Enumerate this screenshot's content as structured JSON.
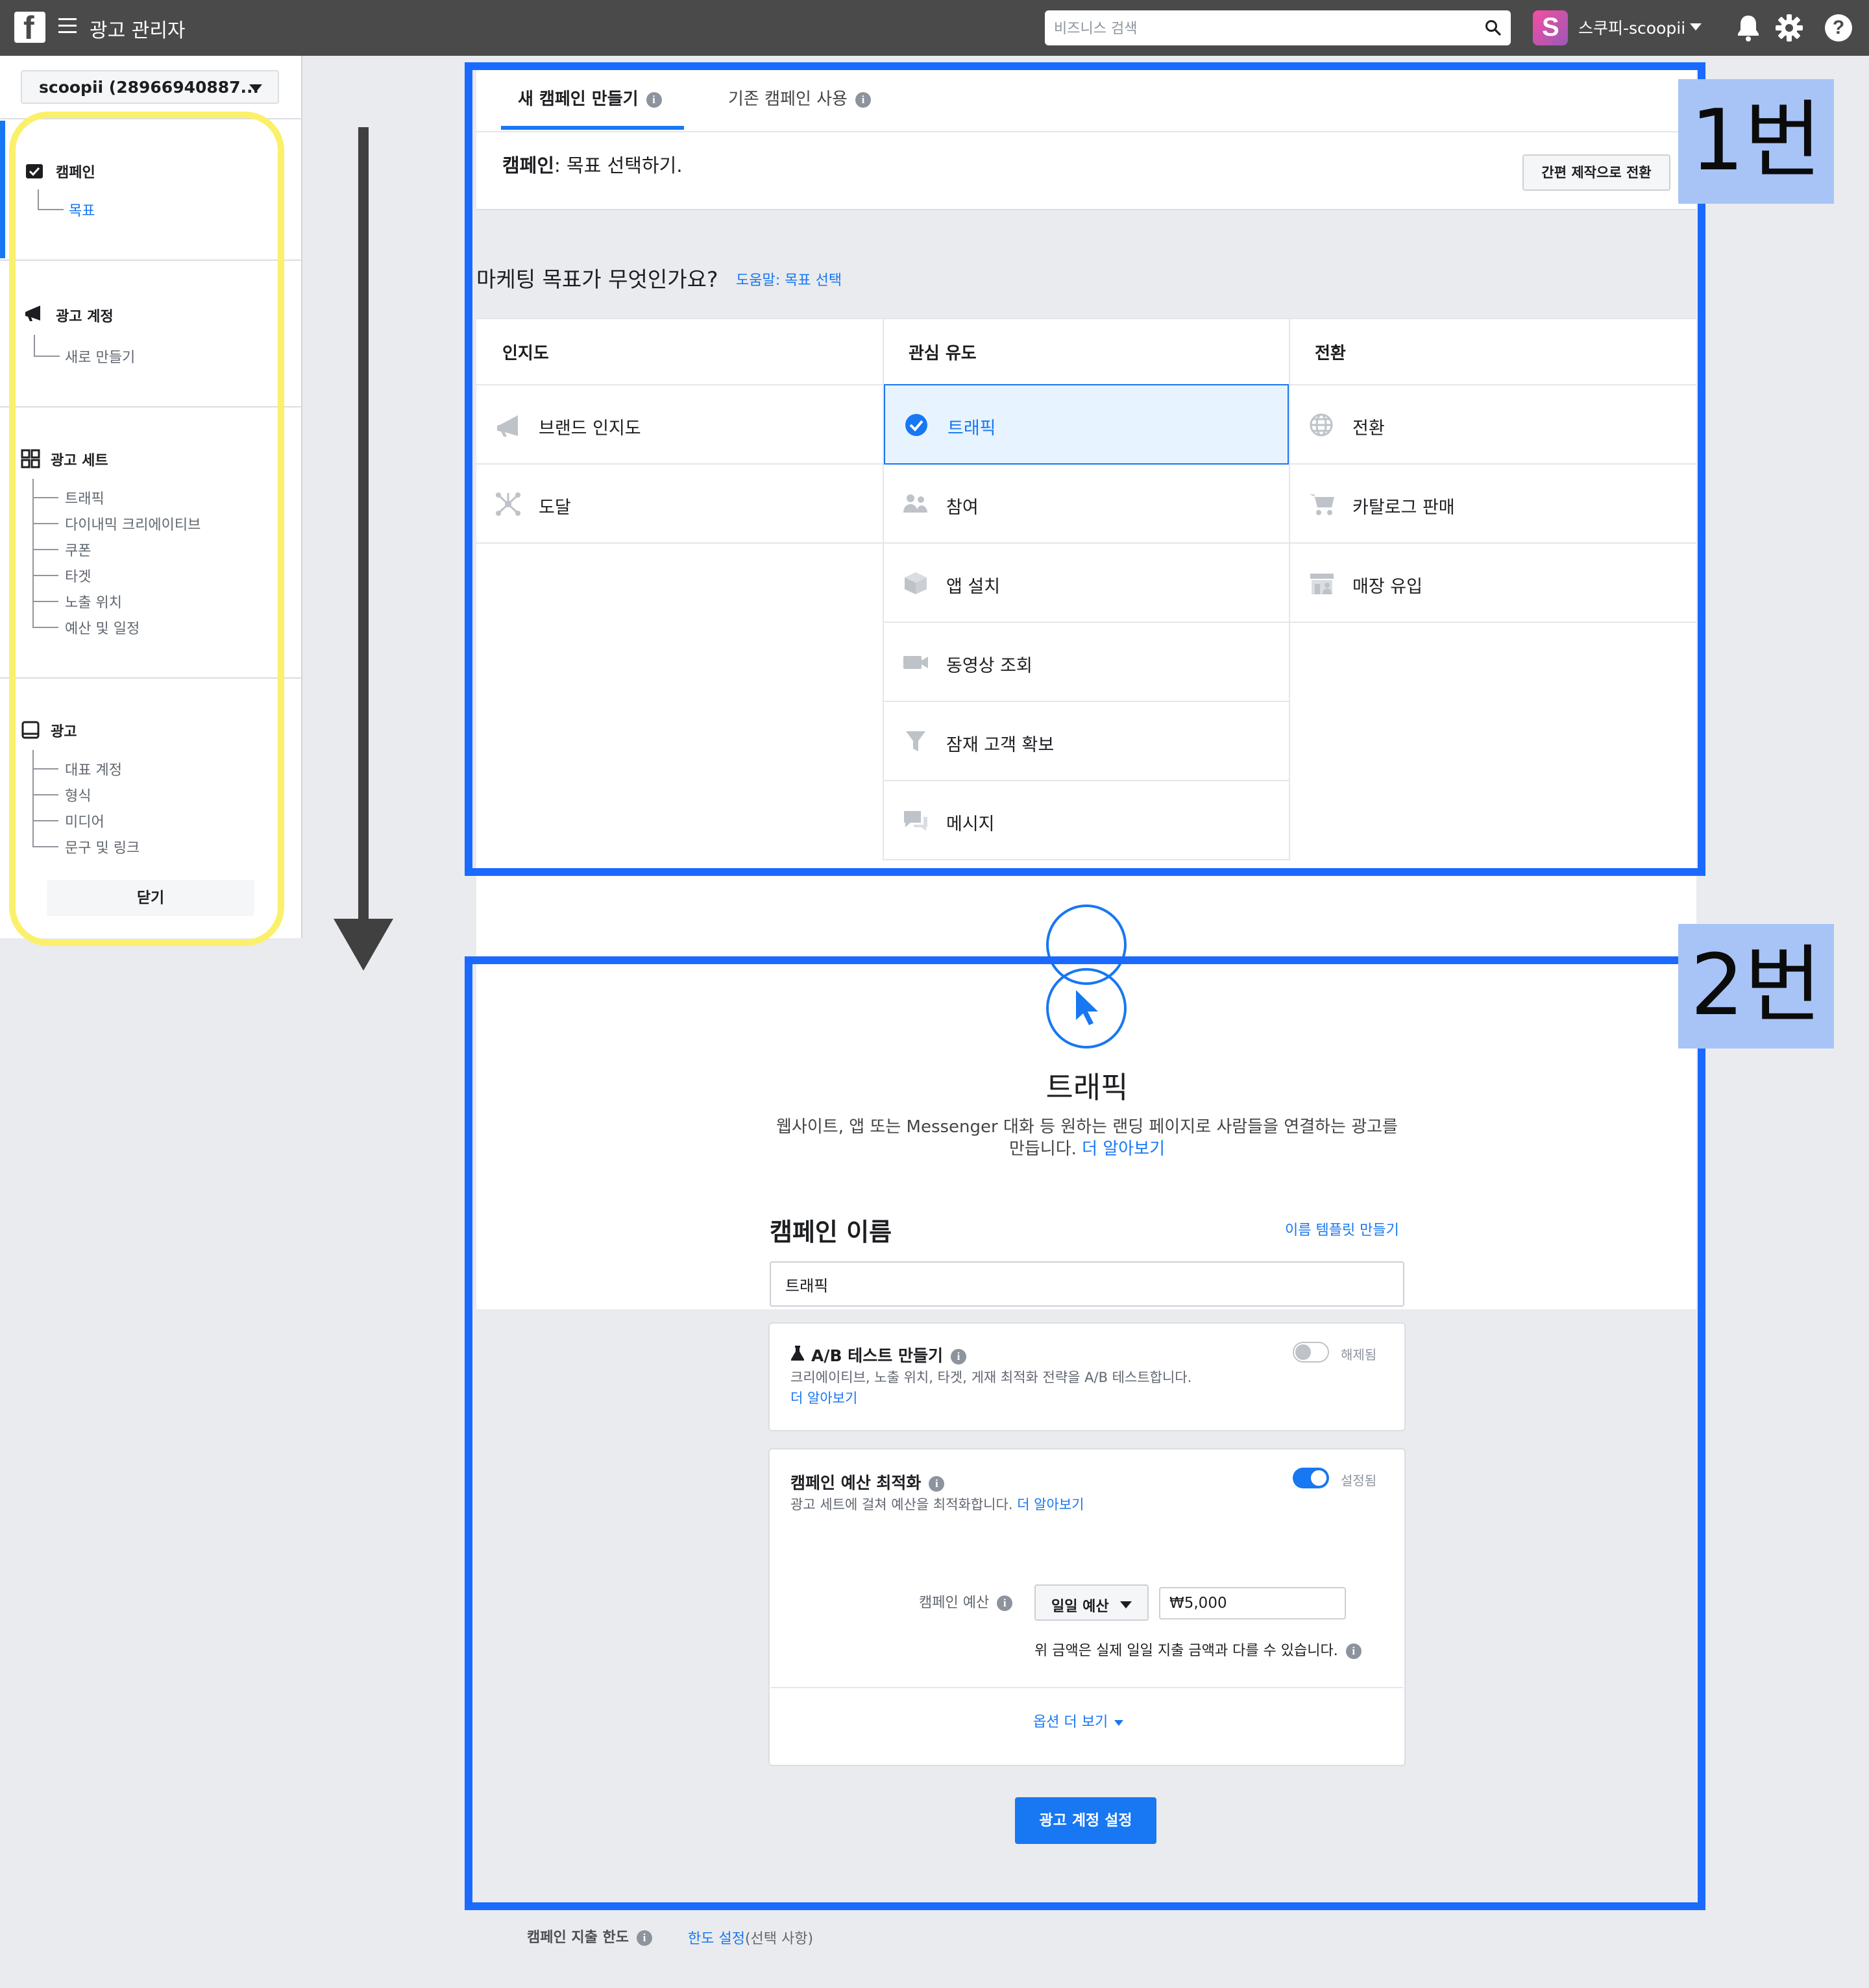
{
  "header": {
    "logo": "f",
    "app_title": "광고 관리자",
    "search_placeholder": "비즈니스 검색",
    "account_initial": "S",
    "account_name": "스쿠피-scoopii",
    "help": "?"
  },
  "sidebar": {
    "account_select": "scoopii (28966940887...",
    "sections": [
      {
        "label": "캠페인",
        "icon": "campaign-check-icon",
        "items": [
          "목표"
        ]
      },
      {
        "label": "광고 계정",
        "icon": "megaphone-icon",
        "items": [
          "새로 만들기"
        ]
      },
      {
        "label": "광고 세트",
        "icon": "grid-icon",
        "items": [
          "트래픽",
          "다이내믹 크리에이티브",
          "쿠폰",
          "타겟",
          "노출 위치",
          "예산 및 일정"
        ]
      },
      {
        "label": "광고",
        "icon": "ad-screen-icon",
        "items": [
          "대표 계정",
          "형식",
          "미디어",
          "문구 및 링크"
        ]
      }
    ],
    "close_label": "닫기"
  },
  "tabs": {
    "new_campaign": "새 캠페인 만들기",
    "existing_campaign": "기존 캠페인 사용"
  },
  "campaign_header": {
    "label": "캠페인",
    "text": ": 목표 선택하기.",
    "quick_button": "간편 제작으로 전환"
  },
  "objective": {
    "question": "마케팅 목표가 무엇인가요?",
    "help_link": "도움말: 목표 선택",
    "columns": [
      {
        "title": "인지도",
        "items": [
          {
            "label": "브랜드 인지도",
            "icon": "megaphone-icon"
          },
          {
            "label": "도달",
            "icon": "reach-icon"
          }
        ]
      },
      {
        "title": "관심 유도",
        "items": [
          {
            "label": "트래픽",
            "icon": "check-circle-icon",
            "selected": true
          },
          {
            "label": "참여",
            "icon": "people-icon"
          },
          {
            "label": "앱 설치",
            "icon": "box-icon"
          },
          {
            "label": "동영상 조회",
            "icon": "video-camera-icon"
          },
          {
            "label": "잠재 고객 확보",
            "icon": "funnel-icon"
          },
          {
            "label": "메시지",
            "icon": "chat-bubbles-icon"
          }
        ]
      },
      {
        "title": "전환",
        "items": [
          {
            "label": "전환",
            "icon": "globe-icon"
          },
          {
            "label": "카탈로그 판매",
            "icon": "cart-icon"
          },
          {
            "label": "매장 유입",
            "icon": "store-icon"
          }
        ]
      }
    ]
  },
  "annotations": {
    "box1": "1번",
    "box2": "2번"
  },
  "traffic": {
    "title": "트래픽",
    "desc_line1": "웹사이트, 앱 또는 Messenger 대화 등 원하는 랜딩 페이지로 사람들을 연결하는 광고를",
    "desc_line2": "만듭니다.",
    "learn_more": "더 알아보기"
  },
  "campaign_name": {
    "heading": "캠페인 이름",
    "template_link": "이름 템플릿 만들기",
    "value": "트래픽"
  },
  "ab_test": {
    "title": "A/B 테스트 만들기",
    "desc": "크리에이티브, 노출 위치, 타겟, 게재 최적화 전략을 A/B 테스트합니다.",
    "learn_more": "더 알아보기",
    "toggle_state": "해제됨",
    "enabled": false
  },
  "cbo": {
    "title": "캠페인 예산 최적화",
    "desc": "광고 세트에 걸쳐 예산을 최적화합니다.",
    "learn_more": "더 알아보기",
    "toggle_state": "설정됨",
    "enabled": true,
    "budget_label": "캠페인 예산",
    "budget_type": "일일 예산",
    "budget_amount": "₩5,000",
    "budget_note": "위 금액은 실제 일일 지출 금액과 다를 수 있습니다.",
    "more_options": "옵션 더 보기"
  },
  "actions": {
    "ad_account_button": "광고 계정 설정"
  },
  "footer": {
    "spend_limit_label": "캠페인 지출 한도",
    "spend_limit_link": "한도 설정",
    "spend_limit_optional": "(선택 사항)"
  },
  "colors": {
    "accent": "#1877f2",
    "annotation_box": "#1a6aff",
    "annotation_badge": "#a8c4f7",
    "sidebar_outline": "#fbf06b"
  }
}
